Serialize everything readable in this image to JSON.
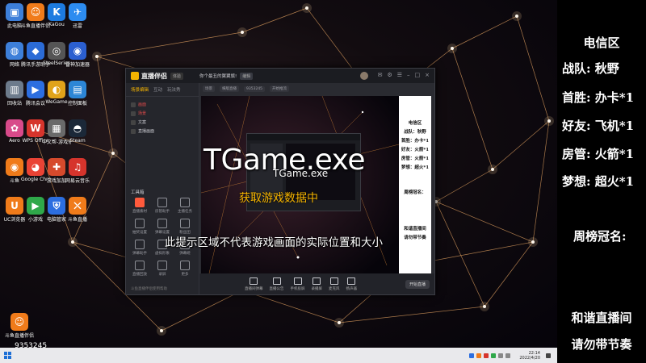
{
  "desktop": {
    "icons": [
      {
        "label": "此电脑",
        "glyph": "▣",
        "color": "#3d7fd9"
      },
      {
        "label": "斗鱼直播伴侣",
        "glyph": "☺",
        "color": "#f07b1a"
      },
      {
        "label": "KaGou",
        "glyph": "K",
        "color": "#1d7be0"
      },
      {
        "label": "迅雷",
        "glyph": "✈",
        "color": "#2d8cf0"
      },
      {
        "label": "网络",
        "glyph": "◍",
        "color": "#3d7fd9"
      },
      {
        "label": "腾讯手游助手",
        "glyph": "◆",
        "color": "#2b6bd6"
      },
      {
        "label": "SteelSeries",
        "glyph": "◎",
        "color": "#555555"
      },
      {
        "label": "雷神加速器",
        "glyph": "◉",
        "color": "#2b5fd0"
      },
      {
        "label": "回收站",
        "glyph": "▥",
        "color": "#6d7b8c"
      },
      {
        "label": "腾讯会议",
        "glyph": "▶",
        "color": "#2c6ee0"
      },
      {
        "label": "WeGame",
        "glyph": "◐",
        "color": "#e0a31a"
      },
      {
        "label": "控制面板",
        "glyph": "▤",
        "color": "#2c86d6"
      },
      {
        "label": "Aero",
        "glyph": "✿",
        "color": "#d84a8a"
      },
      {
        "label": "WPS Office",
        "glyph": "W",
        "color": "#d6342c"
      },
      {
        "label": "中文帮-游戏修复程序",
        "glyph": "▦",
        "color": "#6a6a6a"
      },
      {
        "label": "Steam",
        "glyph": "◓",
        "color": "#1b2838"
      },
      {
        "label": "斗鱼",
        "glyph": "◉",
        "color": "#f07b1a"
      },
      {
        "label": "Google Chrome",
        "glyph": "◕",
        "color": "#ea4335"
      },
      {
        "label": "游戏加加",
        "glyph": "✚",
        "color": "#d64a2c"
      },
      {
        "label": "网易云音乐",
        "glyph": "♫",
        "color": "#d6342c"
      },
      {
        "label": "UC浏览器",
        "glyph": "U",
        "color": "#f07b1a"
      },
      {
        "label": "小游戏",
        "glyph": "▶",
        "color": "#2fa84a"
      },
      {
        "label": "电脑管家",
        "glyph": "⛨",
        "color": "#2c6ee0"
      },
      {
        "label": "斗鱼直播",
        "glyph": "⛌",
        "color": "#f07b1a"
      }
    ],
    "bottom_icon_name": "斗鱼直播伴侣",
    "bottom_icon_id": "9353245"
  },
  "app": {
    "name": "直播伴侣",
    "badge": "体验",
    "room_title": "你个最丑的翼翼旗!",
    "room_edit": "编辑",
    "left_tabs": [
      "场景编辑",
      "互动",
      "玩法秀"
    ],
    "scenes": [
      {
        "label": "画面",
        "red": true
      },
      {
        "label": "场景",
        "red": true
      },
      {
        "label": "文案",
        "red": false
      },
      {
        "label": "直播画面",
        "red": false
      }
    ],
    "tools_title": "工具箱",
    "tools": [
      {
        "label": "直播素材",
        "hot": true
      },
      {
        "label": "房管助手",
        "hot": false
      },
      {
        "label": "主播任务",
        "hot": false
      },
      {
        "label": "抽奖设置",
        "hot": false
      },
      {
        "label": "弹幕设置",
        "hot": false
      },
      {
        "label": "粉丝团",
        "hot": false
      },
      {
        "label": "弹幕助手",
        "hot": false
      },
      {
        "label": "虚拟形象",
        "hot": false
      },
      {
        "label": "弹幕姬",
        "hot": false
      },
      {
        "label": "直播回放",
        "hot": false
      },
      {
        "label": "录屏",
        "hot": false
      },
      {
        "label": "更多",
        "hot": false
      }
    ],
    "left_footer": "斗鱼直播伴侣使用帮助",
    "toolbar": [
      "场景",
      "横版直播",
      "9353245",
      "开始推流"
    ],
    "bottom_tools": [
      "直播间弹幕",
      "直播公告",
      "手机投屏",
      "录播屏",
      "麦克风",
      "扬声器"
    ],
    "start_live_label": "开始直播"
  },
  "preview_panel": [
    "电信区",
    "战队：秋野",
    "首胜：办卡*1",
    "好友：火箭*1",
    "房管：火箭*1",
    "梦想：超火*1",
    "周榜冠名：",
    "和谐直播间",
    "请勿带节奏"
  ],
  "overlay": {
    "tgame_big": "TGame.exe",
    "tgame_small": "TGame.exe",
    "fetching": "获取游戏数据中",
    "hint": "此提示区域不代表游戏画面的实际位置和大小"
  },
  "side_panel": {
    "region": "电信区",
    "rows": [
      "战队:  秋野",
      "首胜:  办卡*1",
      "好友:  飞机*1",
      "房管:  火箭*1",
      "梦想:  超火*1"
    ],
    "weekly": "周榜冠名:",
    "footer1": "和谐直播间",
    "footer2": "请勿带节奏"
  },
  "taskbar": {
    "time": "22:14",
    "date": "2022/4/20"
  }
}
